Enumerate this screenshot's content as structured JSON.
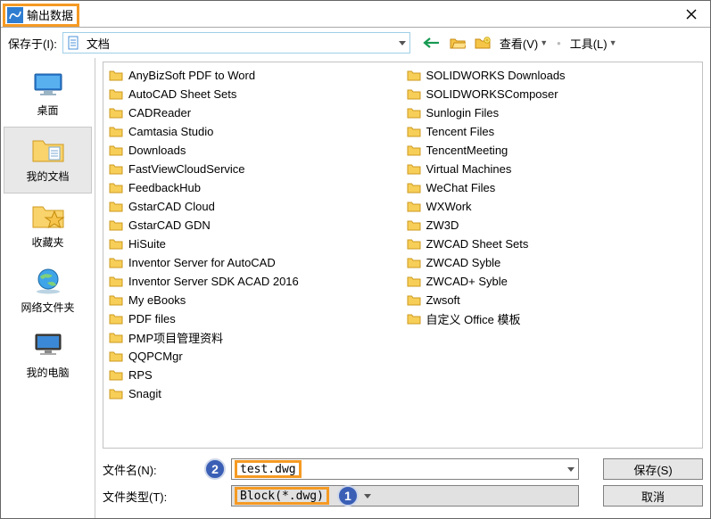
{
  "title": "输出数据",
  "save_in_label": "保存于(I):",
  "path_value": "文档",
  "view_label": "查看(V)",
  "tools_label": "工具(L)",
  "places": [
    {
      "label": "桌面",
      "icon": "desktop"
    },
    {
      "label": "我的文档",
      "icon": "docs",
      "selected": true
    },
    {
      "label": "收藏夹",
      "icon": "fav"
    },
    {
      "label": "网络文件夹",
      "icon": "net"
    },
    {
      "label": "我的电脑",
      "icon": "pc"
    }
  ],
  "files_col1": [
    "AnyBizSoft PDF to Word",
    "AutoCAD Sheet Sets",
    "CADReader",
    "Camtasia Studio",
    "Downloads",
    "FastViewCloudService",
    "FeedbackHub",
    "GstarCAD Cloud",
    "GstarCAD GDN",
    "HiSuite",
    "Inventor Server for AutoCAD",
    "Inventor Server SDK ACAD 2016",
    "My eBooks",
    "PDF files",
    "PMP项目管理资料",
    "QQPCMgr",
    "RPS",
    "Snagit"
  ],
  "files_col2": [
    "SOLIDWORKS Downloads",
    "SOLIDWORKSComposer",
    "Sunlogin Files",
    "Tencent Files",
    "TencentMeeting",
    "Virtual Machines",
    "WeChat Files",
    "WXWork",
    "ZW3D",
    "ZWCAD Sheet Sets",
    "ZWCAD Syble",
    "ZWCAD+ Syble",
    "Zwsoft",
    "自定义 Office 模板"
  ],
  "filename_label": "文件名(N):",
  "filename_value": "test.dwg",
  "filetype_label": "文件类型(T):",
  "filetype_value": "Block(*.dwg)",
  "save_btn": "保存(S)",
  "cancel_btn": "取消",
  "annotations": {
    "badge1": "1",
    "badge2": "2"
  }
}
